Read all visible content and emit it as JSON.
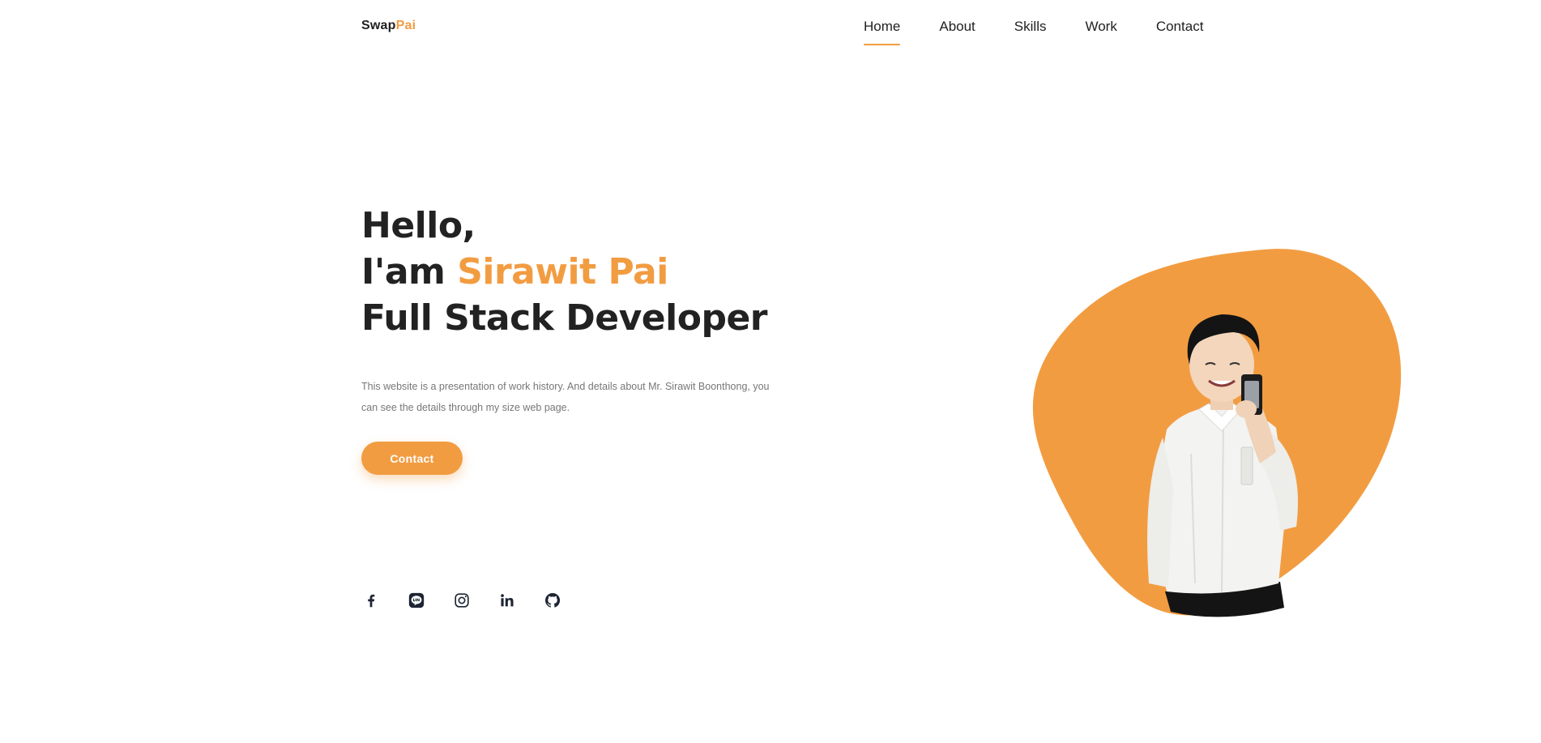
{
  "brand": {
    "logo_primary": "Swap",
    "logo_accent": "Pai",
    "accent_color": "#f29c41",
    "text_color": "#222222"
  },
  "nav": {
    "items": [
      {
        "label": "Home",
        "active": true
      },
      {
        "label": "About",
        "active": false
      },
      {
        "label": "Skills",
        "active": false
      },
      {
        "label": "Work",
        "active": false
      },
      {
        "label": "Contact",
        "active": false
      }
    ]
  },
  "hero": {
    "line1": "Hello,",
    "line2_prefix": "I'am ",
    "name": "Sirawit Pai",
    "line3": "Full Stack Developer",
    "description": "This website is a presentation of work history. And details about Mr. Sirawit Boonthong, you can see the details through my size web page.",
    "button_label": "Contact"
  },
  "socials": [
    {
      "icon": "facebook-icon"
    },
    {
      "icon": "line-icon"
    },
    {
      "icon": "instagram-icon"
    },
    {
      "icon": "linkedin-icon"
    },
    {
      "icon": "github-icon"
    }
  ]
}
